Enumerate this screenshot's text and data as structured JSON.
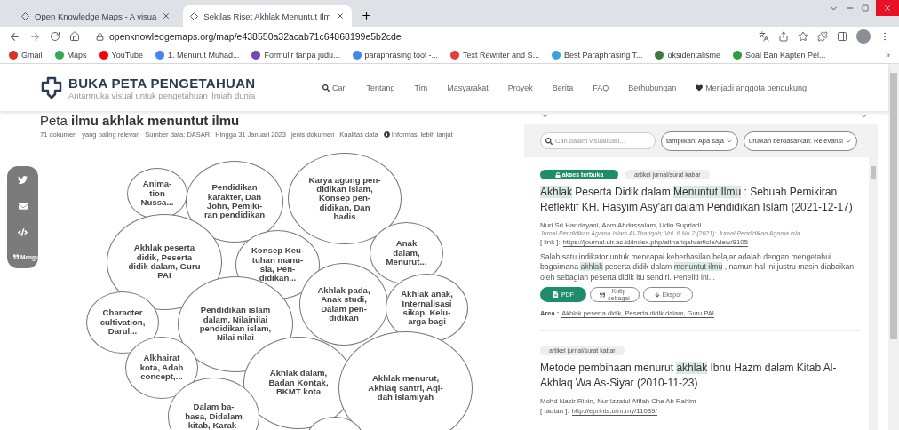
{
  "browser": {
    "tabs": [
      {
        "title": "Open Knowledge Maps - A visua",
        "selected": false
      },
      {
        "title": "Sekilas Riset Akhlak Menuntut Ilm",
        "selected": true
      }
    ],
    "url": "openknowledgemaps.org/map/e438550a32acab71c64868199e5b2cde",
    "bookmarks": [
      {
        "label": "Gmail",
        "color": "#d93025"
      },
      {
        "label": "Maps",
        "color": "#34a853"
      },
      {
        "label": "YouTube",
        "color": "#ff0000"
      },
      {
        "label": "1. Menurut Muhad...",
        "color": "#4285f4"
      },
      {
        "label": "Formulir tanpa judu...",
        "color": "#7248b9"
      },
      {
        "label": "paraphrasing tool -...",
        "color": "#4285f4"
      },
      {
        "label": "Text Rewriter and S...",
        "color": "#e0413a"
      },
      {
        "label": "Best Paraphrasing T...",
        "color": "#3aa0e0"
      },
      {
        "label": "oksidentalisme",
        "color": "#3b7a3b"
      },
      {
        "label": "Soal Ban Kapten Pel...",
        "color": "#2e9e3e"
      }
    ],
    "overflow": "»"
  },
  "site": {
    "title": "BUKA PETA PENGETAHUAN",
    "tagline": "Antarmuka visual untuk pengetahuan ilmiah dunia",
    "nav": [
      {
        "label": "Cari",
        "kind": "search"
      },
      {
        "label": "Tentang",
        "kind": "link"
      },
      {
        "label": "Tim",
        "kind": "link"
      },
      {
        "label": "Masyarakat",
        "kind": "link"
      },
      {
        "label": "Proyek",
        "kind": "link"
      },
      {
        "label": "Berita",
        "kind": "link"
      },
      {
        "label": "FAQ",
        "kind": "link"
      },
      {
        "label": "Berhubungan",
        "kind": "link"
      },
      {
        "label": "Menjadi anggota pendukung",
        "kind": "heart"
      }
    ]
  },
  "map": {
    "title_prefix": "Peta",
    "title_query": "ilmu akhlak menuntut ilmu",
    "meta": [
      {
        "text": "71 dokumen",
        "kind": "text"
      },
      {
        "text": "yang paling relevan",
        "kind": "link"
      },
      {
        "text": "Sumber data: DASAR",
        "kind": "text"
      },
      {
        "text": "Hingga 31 Januari 2023",
        "kind": "text"
      },
      {
        "text": "jenis dokumen",
        "kind": "link"
      },
      {
        "text": "Kualitas data",
        "kind": "link"
      },
      {
        "text": "Informasi lebih lanjut",
        "kind": "info"
      }
    ],
    "share": {
      "cite_label": "Mengu"
    },
    "bubbles": [
      {
        "label": "Anima-\ntion\nNussa..."
      },
      {
        "label": "Pendidikan\nkarakter, Dan\nJohn, Pemiki-\nran pendidikan"
      },
      {
        "label": "Karya agung pen-\ndidikan islam,\nKonsep pen-\ndidikan, Dan\nhadis"
      },
      {
        "label": "Akhlak peserta\ndidik, Peserta\ndidik dalam, Guru\nPAI"
      },
      {
        "label": "Konsep Keu-\ntuhan manu-\nsia, Pen-\ndidikan..."
      },
      {
        "label": "Anak\ndalam,\nMenurut..."
      },
      {
        "label": "Akhlak pada,\nAnak studi,\nDalam pen-\ndidikan"
      },
      {
        "label": "Akhlak anak,\nInternalisasi\nsikap, Kelu-\narga bagi"
      },
      {
        "label": "Character\ncultivation,\nDarul..."
      },
      {
        "label": "Pendidikan islam\ndalam, Nilainilai\npendidikan islam,\nNilai nilai"
      },
      {
        "label": "Alkhairat\nkota, Adab\nconcept,..."
      },
      {
        "label": "Akhlak dalam,\nBadan Kontak,\nBKMT kota"
      },
      {
        "label": "Akhlak menurut,\nAkhlaq santri, Aqi-\ndah Islamiyah"
      },
      {
        "label": "Dalam ba-\nhasa, Didalam\nkitab, Karak-"
      },
      {
        "kind": "partial"
      }
    ]
  },
  "panel": {
    "search_placeholder": "Cari dalam visualisasi...",
    "filters": [
      "tampilkan: Apa saja",
      "urutkan berdasarkan: Relevansi"
    ],
    "documents": [
      {
        "tags": [
          {
            "label": "akses terbuka",
            "kind": "open"
          },
          {
            "label": "artikel jurnal/surat kabar",
            "kind": "type"
          }
        ],
        "title": [
          {
            "text": "Akhlak",
            "hl": true
          },
          {
            "text": " Peserta Didik dalam ",
            "hl": false
          },
          {
            "text": "Menuntut Ilmu",
            "hl": true
          },
          {
            "text": " : Sebuah Pemikiran Reflektif KH. Hasyim Asy'ari dalam Pendidikan Islam (2021-12-17)",
            "hl": false
          }
        ],
        "authors": "Nuri Sri Handayani, Aam Abdussalam, Udin Supriadi",
        "journal": "Jurnal Pendidikan Agama Islam Al-Thariqah; Vol. 6 No.2 (2021): Jurnal Pendidikan Agama Isla...",
        "link_label": "[ link ]:",
        "link": "https://journal.uir.ac.id/index.php/althariqah/article/view/8105",
        "snippet": [
          {
            "text": "Salah satu indikator untuk mencapai keberhasilan belajar adalah dengan mengetahui bagaimana ",
            "hl": false
          },
          {
            "text": "akhlak",
            "hl": true
          },
          {
            "text": " peserta didik dalam ",
            "hl": false
          },
          {
            "text": "menuntut ilmu",
            "hl": true
          },
          {
            "text": " , namun hal ini justru masih diabaikan oleh sebagian peserta didik itu sendiri. Peneliti ini...",
            "hl": false
          }
        ],
        "actions": [
          {
            "label": "PDF",
            "kind": "pdf"
          },
          {
            "label": "Kutip\nsebagai",
            "kind": "cite"
          },
          {
            "label": "Ekspor",
            "kind": "export"
          }
        ],
        "area_label": "Area :",
        "area": "Akhlak peserta didik, Peserta didik dalam, Guru PAI"
      },
      {
        "tags": [
          {
            "label": "artikel jurnal/surat kabar",
            "kind": "type"
          }
        ],
        "title": [
          {
            "text": "Metode pembinaan menurut ",
            "hl": false
          },
          {
            "text": "akhlak",
            "hl": true
          },
          {
            "text": " Ibnu Hazm dalam Kitab Al-Akhlaq Wa As-Siyar (2010-11-23)",
            "hl": false
          }
        ],
        "authors": "Mohd Nasir Ripin, Nur Izzatul Afifah Che Ab Rahim",
        "link_label": "[ tautan ]:",
        "link": "http://eprints.utm.my/11039/"
      }
    ]
  }
}
